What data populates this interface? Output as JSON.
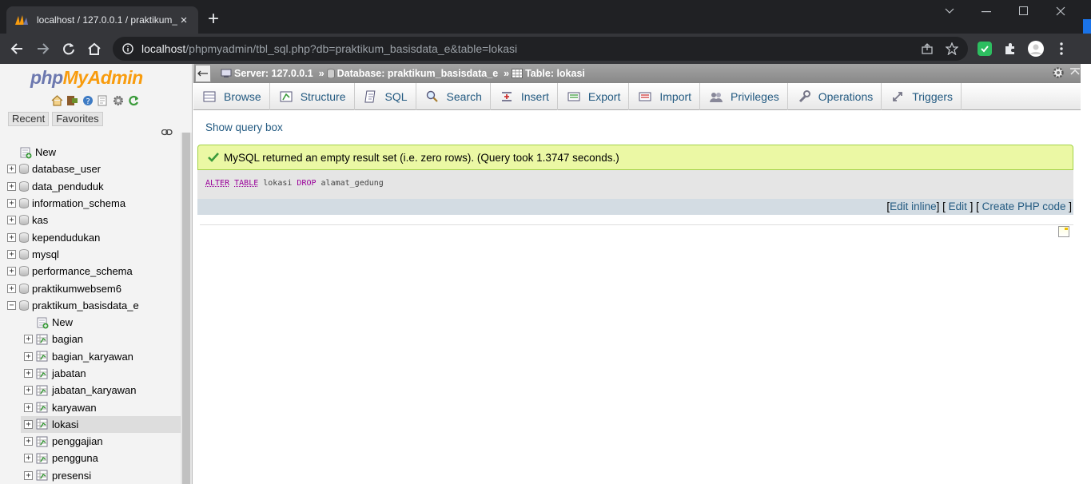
{
  "browser": {
    "tab_title": "localhost / 127.0.0.1 / praktikum_",
    "tab_close": "×",
    "new_tab": "+",
    "url_host": "localhost",
    "url_path": "/phpmyadmin/tbl_sql.php?db=praktikum_basisdata_e&table=lokasi"
  },
  "sidebar": {
    "logo_php": "php",
    "logo_myadmin": "MyAdmin",
    "tabs": [
      "Recent",
      "Favorites"
    ],
    "tree": [
      {
        "label": "New",
        "type": "new",
        "level": 0
      },
      {
        "label": "database_user",
        "type": "db",
        "level": 0
      },
      {
        "label": "data_penduduk",
        "type": "db",
        "level": 0
      },
      {
        "label": "information_schema",
        "type": "db",
        "level": 0
      },
      {
        "label": "kas",
        "type": "db",
        "level": 0
      },
      {
        "label": "kependudukan",
        "type": "db",
        "level": 0
      },
      {
        "label": "mysql",
        "type": "db",
        "level": 0
      },
      {
        "label": "performance_schema",
        "type": "db",
        "level": 0
      },
      {
        "label": "praktikumwebsem6",
        "type": "db",
        "level": 0
      },
      {
        "label": "praktikum_basisdata_e",
        "type": "db-open",
        "level": 0
      },
      {
        "label": "New",
        "type": "new",
        "level": 1
      },
      {
        "label": "bagian",
        "type": "table",
        "level": 1
      },
      {
        "label": "bagian_karyawan",
        "type": "table",
        "level": 1
      },
      {
        "label": "jabatan",
        "type": "table",
        "level": 1
      },
      {
        "label": "jabatan_karyawan",
        "type": "table",
        "level": 1
      },
      {
        "label": "karyawan",
        "type": "table",
        "level": 1
      },
      {
        "label": "lokasi",
        "type": "table",
        "level": 1,
        "selected": true
      },
      {
        "label": "penggajian",
        "type": "table",
        "level": 1
      },
      {
        "label": "pengguna",
        "type": "table",
        "level": 1
      },
      {
        "label": "presensi",
        "type": "table",
        "level": 1
      }
    ]
  },
  "breadcrumb": {
    "server": "Server: 127.0.0.1",
    "database": "Database: praktikum_basisdata_e",
    "table": "Table: lokasi",
    "sep": "»"
  },
  "menu": [
    {
      "label": "Browse",
      "icon": "browse-icon"
    },
    {
      "label": "Structure",
      "icon": "structure-icon"
    },
    {
      "label": "SQL",
      "icon": "sql-icon"
    },
    {
      "label": "Search",
      "icon": "search-icon"
    },
    {
      "label": "Insert",
      "icon": "insert-icon"
    },
    {
      "label": "Export",
      "icon": "export-icon"
    },
    {
      "label": "Import",
      "icon": "import-icon"
    },
    {
      "label": "Privileges",
      "icon": "privileges-icon"
    },
    {
      "label": "Operations",
      "icon": "wrench-icon"
    },
    {
      "label": "Triggers",
      "icon": "triggers-icon"
    }
  ],
  "content": {
    "show_query_box": "Show query box",
    "success_message": "MySQL returned an empty result set (i.e. zero rows). (Query took 1.3747 seconds.)",
    "sql_kw1": "ALTER",
    "sql_kw2": "TABLE",
    "sql_t1": " lokasi ",
    "sql_kw3": "DROP",
    "sql_t2": " alamat_gedung",
    "edit_inline": "Edit inline",
    "edit": "Edit",
    "create_php": "Create PHP code"
  },
  "colors": {
    "link": "#235a81",
    "success_bg": "#ebf8a4",
    "logo_php": "#6c78af",
    "logo_myadmin": "#f89c0e"
  }
}
